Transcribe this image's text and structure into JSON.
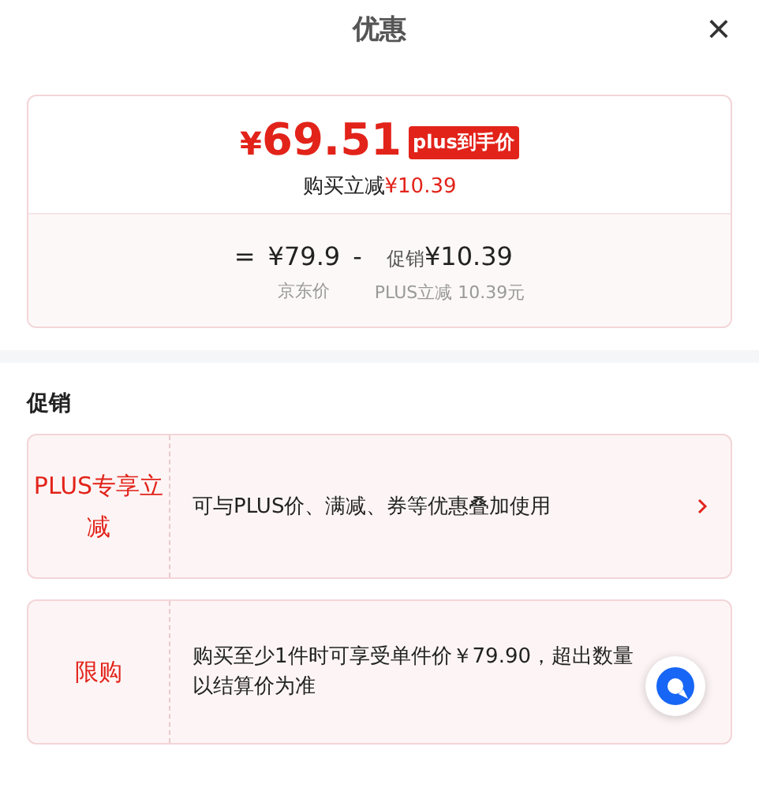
{
  "header": {
    "title": "优惠",
    "close": "×"
  },
  "price_card": {
    "currency": "¥",
    "amount": "69.51",
    "badge": "plus到手价",
    "saving_label": "购买立减",
    "saving_value": "¥10.39",
    "formula": [
      {
        "kind": "op",
        "text": "="
      },
      {
        "kind": "price",
        "text": "¥79.9",
        "note": "京东价"
      },
      {
        "kind": "op",
        "text": "-"
      },
      {
        "kind": "price",
        "prefix": "促销",
        "text": "¥10.39",
        "note": "PLUS立减 10.39元"
      }
    ]
  },
  "section": {
    "title": "促销"
  },
  "promotions": [
    {
      "tag": "PLUS专享立减",
      "text": "可与PLUS价、满减、券等优惠叠加使用",
      "arrow": true
    },
    {
      "tag": "限购",
      "text": "购买至少1件时可享受单件价￥79.90，超出数量以结算价为准",
      "arrow": false
    }
  ]
}
